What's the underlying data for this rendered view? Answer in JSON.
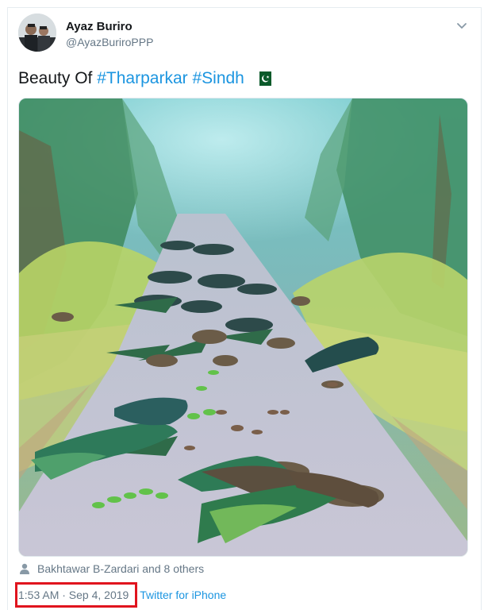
{
  "tweet": {
    "author_name": "Ayaz Buriro",
    "author_handle": "@AyazBuriroPPP",
    "text_plain": "Beauty Of",
    "hashtags": [
      "#Tharparkar",
      "#Sindh"
    ],
    "liked_by": "Bakhtawar B-Zardari and 8 others",
    "timestamp": "1:53 AM · Sep 4, 2019",
    "client": "Twitter for iPhone"
  },
  "icons": {
    "avatar": "profile-photo",
    "caret": "chevron-down-icon",
    "flag": "pakistan-flag-icon",
    "person": "person-icon"
  },
  "colors": {
    "link": "#1b95e0",
    "text": "#14171a",
    "secondary": "#657786",
    "highlight_box": "#e0141e"
  }
}
